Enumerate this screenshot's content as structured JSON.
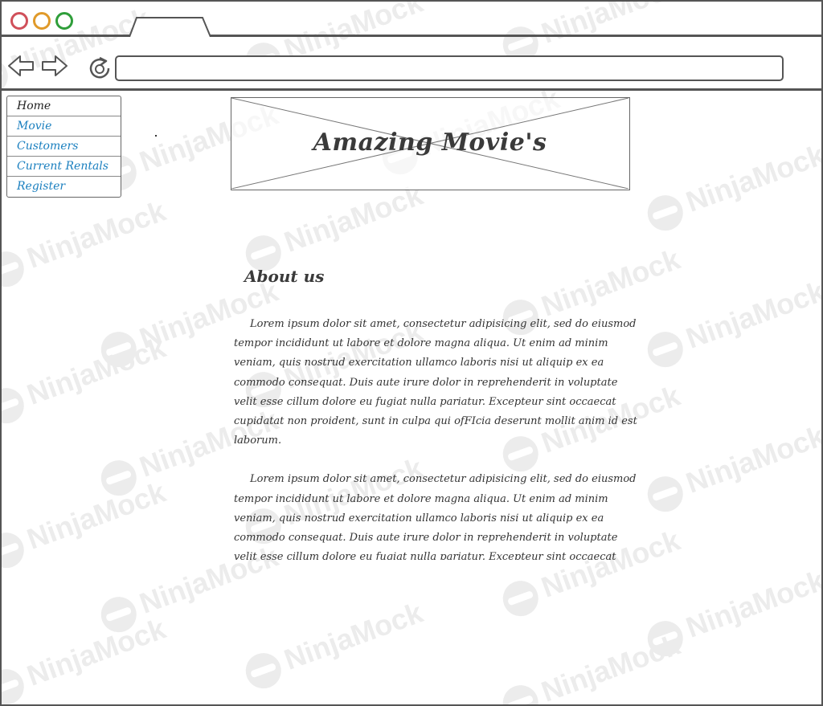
{
  "browser": {
    "address_value": "",
    "icons": {
      "back": "arrow-left-icon",
      "forward": "arrow-right-icon",
      "reload": "reload-icon"
    },
    "colors": {
      "close": "#d0505a",
      "minimize": "#e09a2a",
      "maximize": "#2f9e3a"
    }
  },
  "menu": {
    "items": [
      {
        "label": "Home",
        "active": true
      },
      {
        "label": "Movie",
        "active": false
      },
      {
        "label": "Customers",
        "active": false
      },
      {
        "label": "Current Rentals",
        "active": false
      },
      {
        "label": "Register",
        "active": false
      }
    ],
    "link_color": "#1a7fbf"
  },
  "banner": {
    "title": "Amazing Movie's"
  },
  "about": {
    "heading": "About us",
    "paragraphs": [
      "Lorem ipsum dolor sit amet, consectetur adipisicing elit, sed do eiusmod tempor incididunt ut labore et dolore magna aliqua. Ut enim ad minim veniam, quis nostrud exercitation ullamco laboris nisi ut aliquip ex ea commodo consequat. Duis aute irure dolor in reprehenderit in voluptate velit esse cillum dolore eu fugiat nulla pariatur. Excepteur sint occaecat cupidatat non proident, sunt in culpa qui ofFIcia deserunt mollit anim id est laborum.",
      "Lorem ipsum dolor sit amet, consectetur adipisicing elit, sed do eiusmod tempor incididunt ut labore et dolore magna aliqua. Ut enim ad minim veniam, quis nostrud exercitation ullamco laboris nisi ut aliquip ex ea commodo consequat. Duis aute irure dolor in reprehenderit in voluptate velit esse cillum dolore eu fugiat nulla pariatur. Excepteur sint occaecat cupidatat non proident, sunt in culpa qui ofFIcia deserunt mollit anim id est laborum."
    ]
  },
  "watermark": {
    "text": "NinjaMock"
  }
}
